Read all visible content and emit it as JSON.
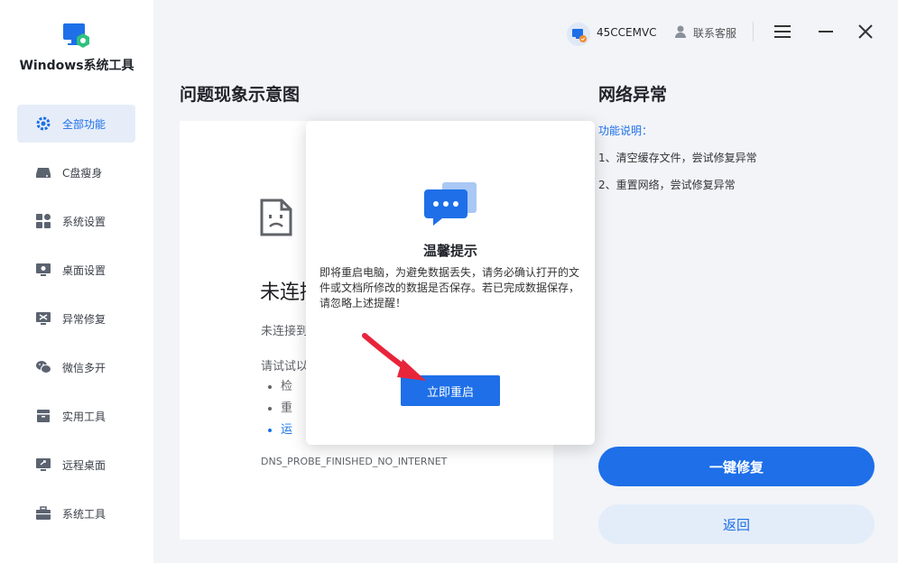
{
  "app": {
    "name": "Windows系统工具",
    "brand_color": "#1e6fe8"
  },
  "sidebar": {
    "items": [
      {
        "label": "全部功能",
        "icon": "gear-icon",
        "active": true
      },
      {
        "label": "C盘瘦身",
        "icon": "disk-icon"
      },
      {
        "label": "系统设置",
        "icon": "grid-icon"
      },
      {
        "label": "桌面设置",
        "icon": "monitor-gear-icon"
      },
      {
        "label": "异常修复",
        "icon": "repair-icon"
      },
      {
        "label": "微信多开",
        "icon": "wechat-icon"
      },
      {
        "label": "实用工具",
        "icon": "toolbox-icon"
      },
      {
        "label": "远程桌面",
        "icon": "remote-desktop-icon"
      },
      {
        "label": "系统工具",
        "icon": "briefcase-icon"
      }
    ]
  },
  "topbar": {
    "user_name": "45CCEMVC",
    "support_label": "联系客服"
  },
  "main": {
    "left_title": "问题现象示意图",
    "right_title": "网络异常"
  },
  "demo": {
    "title": "未连接",
    "subtitle": "未连接到",
    "try_text": "请试试以",
    "bullets": [
      "检",
      "重",
      "运"
    ],
    "error_code": "DNS_PROBE_FINISHED_NO_INTERNET"
  },
  "dialog": {
    "title": "温馨提示",
    "message": "即将重启电脑，为避免数据丢失，请务必确认打开的文件或文档所修改的数据是否保存。若已完成数据保存，请忽略上述提醒！",
    "button_label": "立即重启"
  },
  "description": {
    "heading": "功能说明：",
    "items": [
      "1、清空缓存文件，尝试修复异常",
      "2、重置网络，尝试修复异常"
    ]
  },
  "actions": {
    "primary_label": "一键修复",
    "secondary_label": "返回"
  }
}
